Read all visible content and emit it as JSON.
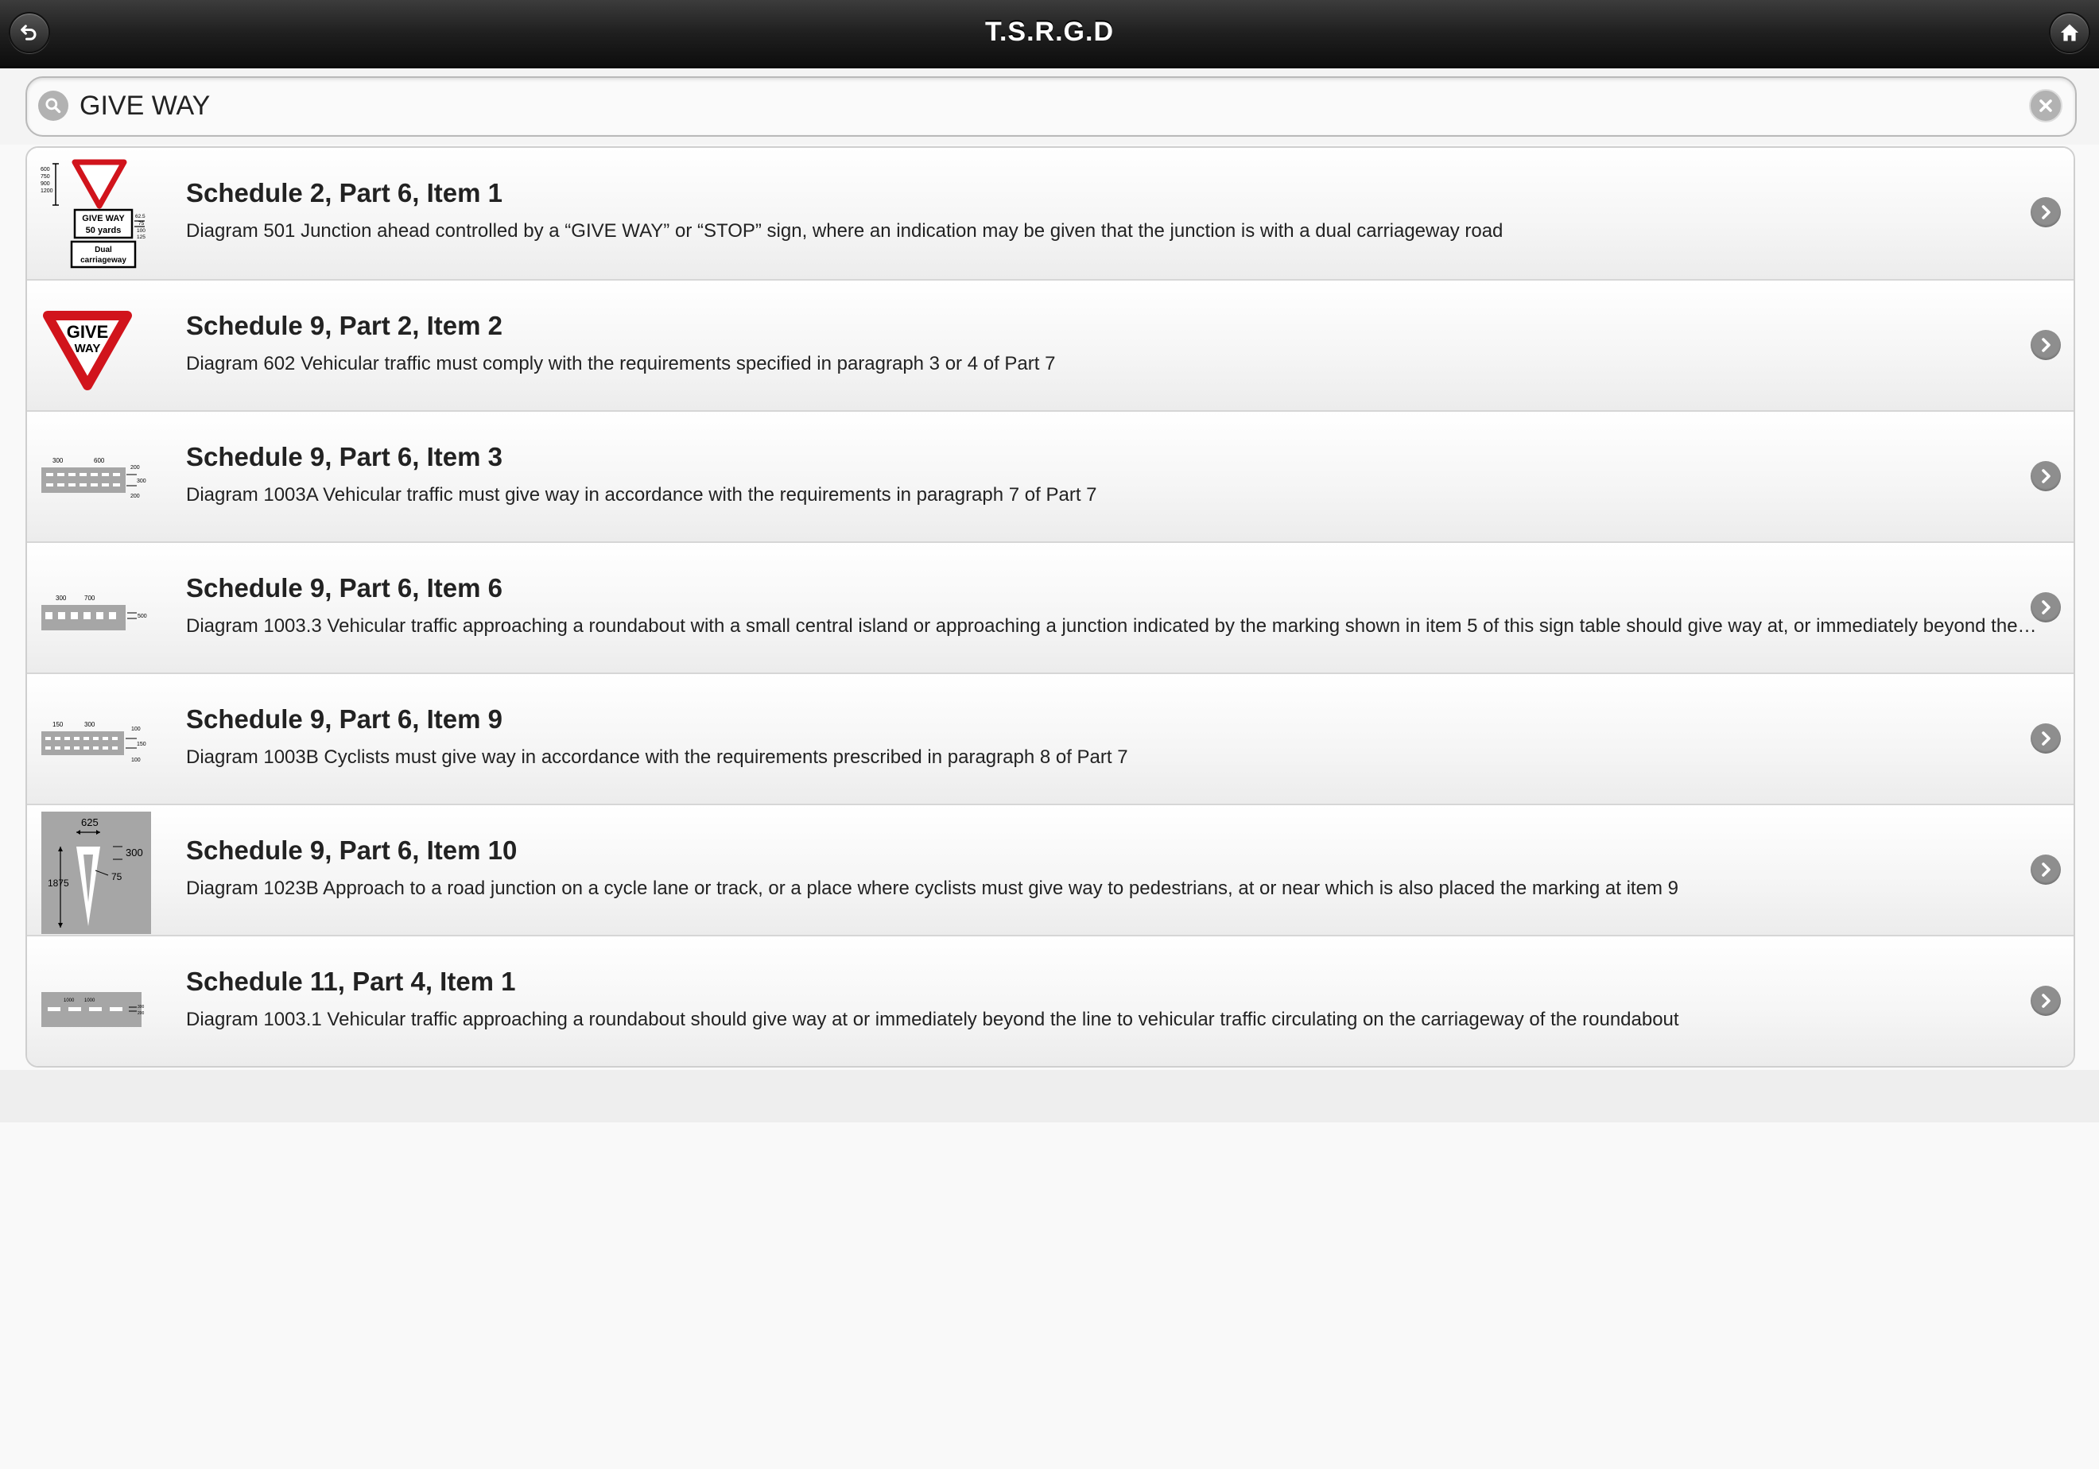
{
  "header": {
    "title": "T.S.R.G.D",
    "back_icon": "back-arrow-icon",
    "home_icon": "home-icon"
  },
  "search": {
    "value": "GIVE WAY",
    "placeholder": "",
    "icon": "search-icon",
    "clear_icon": "clear-icon"
  },
  "results": [
    {
      "title": "Schedule 2, Part 6, Item 1",
      "description": "Diagram 501 Junction ahead controlled by a “GIVE WAY” or “STOP” sign, where an indication may be given that the junction is with a dual carriageway road",
      "thumb": {
        "icon": "give-way-distance-sign-icon",
        "heights": [
          "600",
          "750",
          "900",
          "1200"
        ],
        "plate_line1": "GIVE WAY",
        "plate_line2": "50 yards",
        "plate_sizes": [
          "62.5",
          "75",
          "100",
          "125"
        ],
        "sub_plate_line1": "Dual",
        "sub_plate_line2": "carriageway"
      }
    },
    {
      "title": "Schedule 9, Part 2, Item 2",
      "description": "Diagram 602 Vehicular traffic must comply with the requirements specified in paragraph 3 or 4 of Part 7",
      "thumb": {
        "icon": "give-way-sign-icon",
        "line1": "GIVE",
        "line2": "WAY"
      }
    },
    {
      "title": "Schedule 9, Part 6, Item 3",
      "description": "Diagram 1003A Vehicular traffic must give way in accordance with the requirements in paragraph 7 of Part 7",
      "thumb": {
        "icon": "double-dashed-give-way-marking-icon",
        "top_left": "300",
        "top_right": "600",
        "right_top": "200",
        "right_mid": "300",
        "right_bottom": "200"
      }
    },
    {
      "title": "Schedule 9, Part 6, Item 6",
      "description": "Diagram 1003.3 Vehicular traffic approaching a roundabout with a small central island or approaching a junction indicated by the marking shown in item 5 of this sign table should give way at, or immediately beyond the line to vehicular traffic circulating on the roundabout",
      "thumb": {
        "icon": "roundabout-give-way-marking-icon",
        "top_left": "300",
        "top_right": "700",
        "right_mid": "500"
      }
    },
    {
      "title": "Schedule 9, Part 6, Item 9",
      "description": "Diagram 1003B Cyclists must give way in accordance with the requirements prescribed in paragraph 8 of Part 7",
      "thumb": {
        "icon": "cycle-give-way-marking-icon",
        "top_left": "150",
        "top_right": "300",
        "right_top": "100",
        "right_mid": "150",
        "right_bottom": "100"
      }
    },
    {
      "title": "Schedule 9, Part 6, Item 10",
      "description": "Diagram 1023B Approach to a road junction on a cycle lane or track, or a place where cyclists must give way to pedestrians, at or near which is also placed the marking at item 9",
      "thumb": {
        "icon": "triangle-road-marking-icon",
        "width_label": "625",
        "height_label": "1875",
        "side_label": "300",
        "inner_label": "75"
      }
    },
    {
      "title": "Schedule 11, Part 4, Item 1",
      "description": "Diagram 1003.1 Vehicular traffic approaching a roundabout should give way at or immediately beyond the line to vehicular traffic circulating on the carriageway of the roundabout",
      "thumb": {
        "icon": "single-dashed-give-way-marking-icon",
        "top_left": "1000",
        "top_right": "1000",
        "right_top": "300",
        "right_bottom": "200"
      }
    }
  ],
  "row_chevron_icon": "chevron-right-icon",
  "colors": {
    "header_dark": "#0d0d0d",
    "sign_red": "#d1141c",
    "marking_grey": "#a6a6a6",
    "chevron_grey": "#8e8e8e"
  }
}
